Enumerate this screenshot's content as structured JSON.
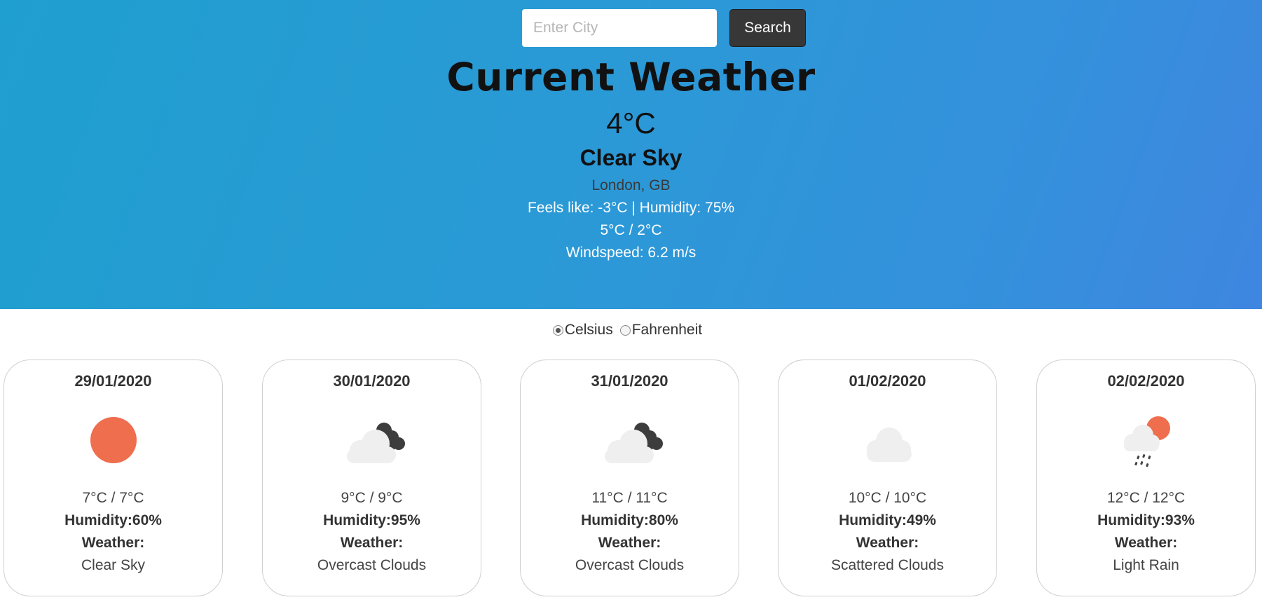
{
  "search": {
    "placeholder": "Enter City",
    "button_label": "Search"
  },
  "current": {
    "title": "Current Weather",
    "temperature": "4°C",
    "description": "Clear Sky",
    "location": "London, GB",
    "feels_humidity": "Feels like: -3°C | Humidity: 75%",
    "range": "5°C / 2°C",
    "windspeed": "Windspeed: 6.2 m/s"
  },
  "units": {
    "options": [
      {
        "label": "Celsius",
        "checked": true
      },
      {
        "label": "Fahrenheit",
        "checked": false
      }
    ]
  },
  "forecast": [
    {
      "date": "29/01/2020",
      "icon": "clear-sky-icon",
      "range": "7°C / 7°C",
      "humidity": "Humidity:60%",
      "weather_label": "Weather:",
      "weather": "Clear Sky"
    },
    {
      "date": "30/01/2020",
      "icon": "overcast-clouds-icon",
      "range": "9°C / 9°C",
      "humidity": "Humidity:95%",
      "weather_label": "Weather:",
      "weather": "Overcast Clouds"
    },
    {
      "date": "31/01/2020",
      "icon": "overcast-clouds-icon",
      "range": "11°C / 11°C",
      "humidity": "Humidity:80%",
      "weather_label": "Weather:",
      "weather": "Overcast Clouds"
    },
    {
      "date": "01/02/2020",
      "icon": "scattered-clouds-icon",
      "range": "10°C / 10°C",
      "humidity": "Humidity:49%",
      "weather_label": "Weather:",
      "weather": "Scattered Clouds"
    },
    {
      "date": "02/02/2020",
      "icon": "light-rain-icon",
      "range": "12°C / 12°C",
      "humidity": "Humidity:93%",
      "weather_label": "Weather:",
      "weather": "Light Rain"
    }
  ],
  "colors": {
    "sun": "#ee6e4e",
    "cloud_light": "#efefef",
    "cloud_dark": "#3d3d3d",
    "rain": "#444444",
    "search_button": "#373737"
  }
}
